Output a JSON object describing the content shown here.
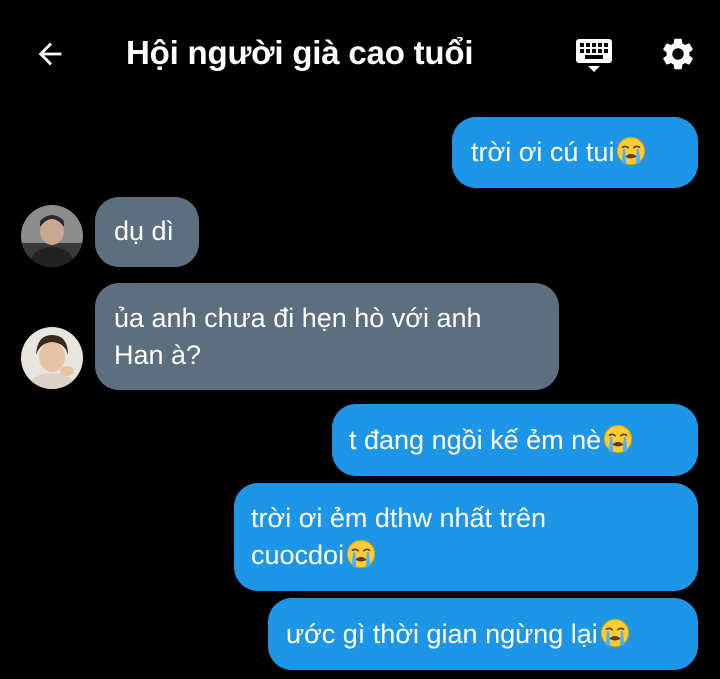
{
  "header": {
    "title": "Hội người già cao tuổi",
    "back_icon": "arrow-left-icon",
    "keyboard_icon": "keyboard-icon",
    "settings_icon": "gear-icon"
  },
  "colors": {
    "background": "#000000",
    "sent_bubble": "#1e96e8",
    "received_bubble": "#5d6f7e",
    "text": "#ffffff"
  },
  "messages": [
    {
      "direction": "sent",
      "lines": [
        "trời ơi cú tui"
      ],
      "emoji": "crying-face-emoji"
    },
    {
      "direction": "received",
      "lines": [
        "dụ dì"
      ],
      "avatar": "avatar-1"
    },
    {
      "direction": "received",
      "lines": [
        "ủa anh chưa đi hẹn hò với anh",
        "Han à?"
      ],
      "avatar": "avatar-2"
    },
    {
      "direction": "sent",
      "lines": [
        "t đang ngồi kế ẻm nè"
      ],
      "emoji": "crying-face-emoji"
    },
    {
      "direction": "sent",
      "lines": [
        "trời ơi ẻm dthw nhất trên",
        "cuocdoi"
      ],
      "emoji": "crying-face-emoji"
    },
    {
      "direction": "sent",
      "lines": [
        "ước gì thời gian ngừng lại"
      ],
      "emoji": "crying-face-emoji"
    }
  ]
}
